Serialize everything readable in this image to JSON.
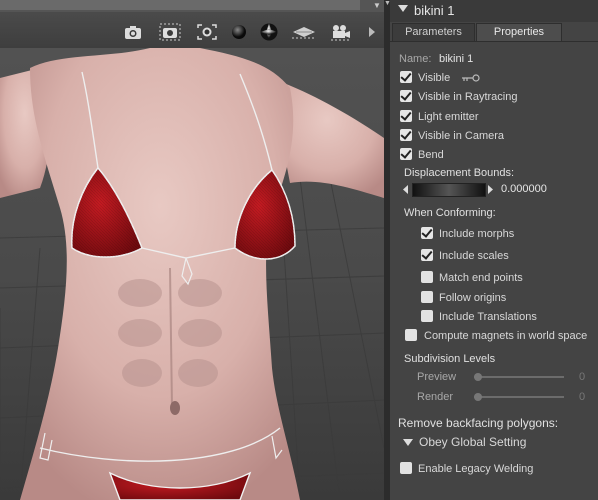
{
  "panel": {
    "title": "bikini 1",
    "tabs": [
      {
        "label": "Parameters"
      },
      {
        "label": "Properties"
      }
    ],
    "name_label": "Name:",
    "name_value": "bikini 1",
    "properties": [
      {
        "label": "Visible",
        "checked": true
      },
      {
        "label": "Visible in Raytracing",
        "checked": true
      },
      {
        "label": "Light emitter",
        "checked": true
      },
      {
        "label": "Visible in Camera",
        "checked": true
      },
      {
        "label": "Bend",
        "checked": true
      }
    ],
    "displacement_label": "Displacement Bounds:",
    "displacement_value": "0.000000",
    "conforming_label": "When Conforming:",
    "conforming": [
      {
        "label": "Include morphs",
        "checked": true
      },
      {
        "label": "Include scales",
        "checked": true
      },
      {
        "label": "Match end points",
        "checked": false
      },
      {
        "label": "Follow origins",
        "checked": false
      },
      {
        "label": "Include Translations",
        "checked": false
      }
    ],
    "compute_magnets": {
      "label": "Compute magnets in world space",
      "checked": false
    },
    "subdivision_label": "Subdivision Levels",
    "subdivision": [
      {
        "label": "Preview",
        "value": "0"
      },
      {
        "label": "Render",
        "value": "0"
      }
    ],
    "backfacing_label": "Remove backfacing polygons:",
    "backfacing_value": "Obey Global Setting",
    "legacy_welding": {
      "label": "Enable Legacy Welding",
      "checked": false
    }
  },
  "viewport": {
    "toolbar_icons": [
      "camera-icon",
      "camera-selection-icon",
      "camera-frame-icon",
      "sphere-icon",
      "lighting-sphere-icon",
      "ground-plane-icon",
      "movie-camera-icon",
      "play-arrow-icon"
    ]
  }
}
